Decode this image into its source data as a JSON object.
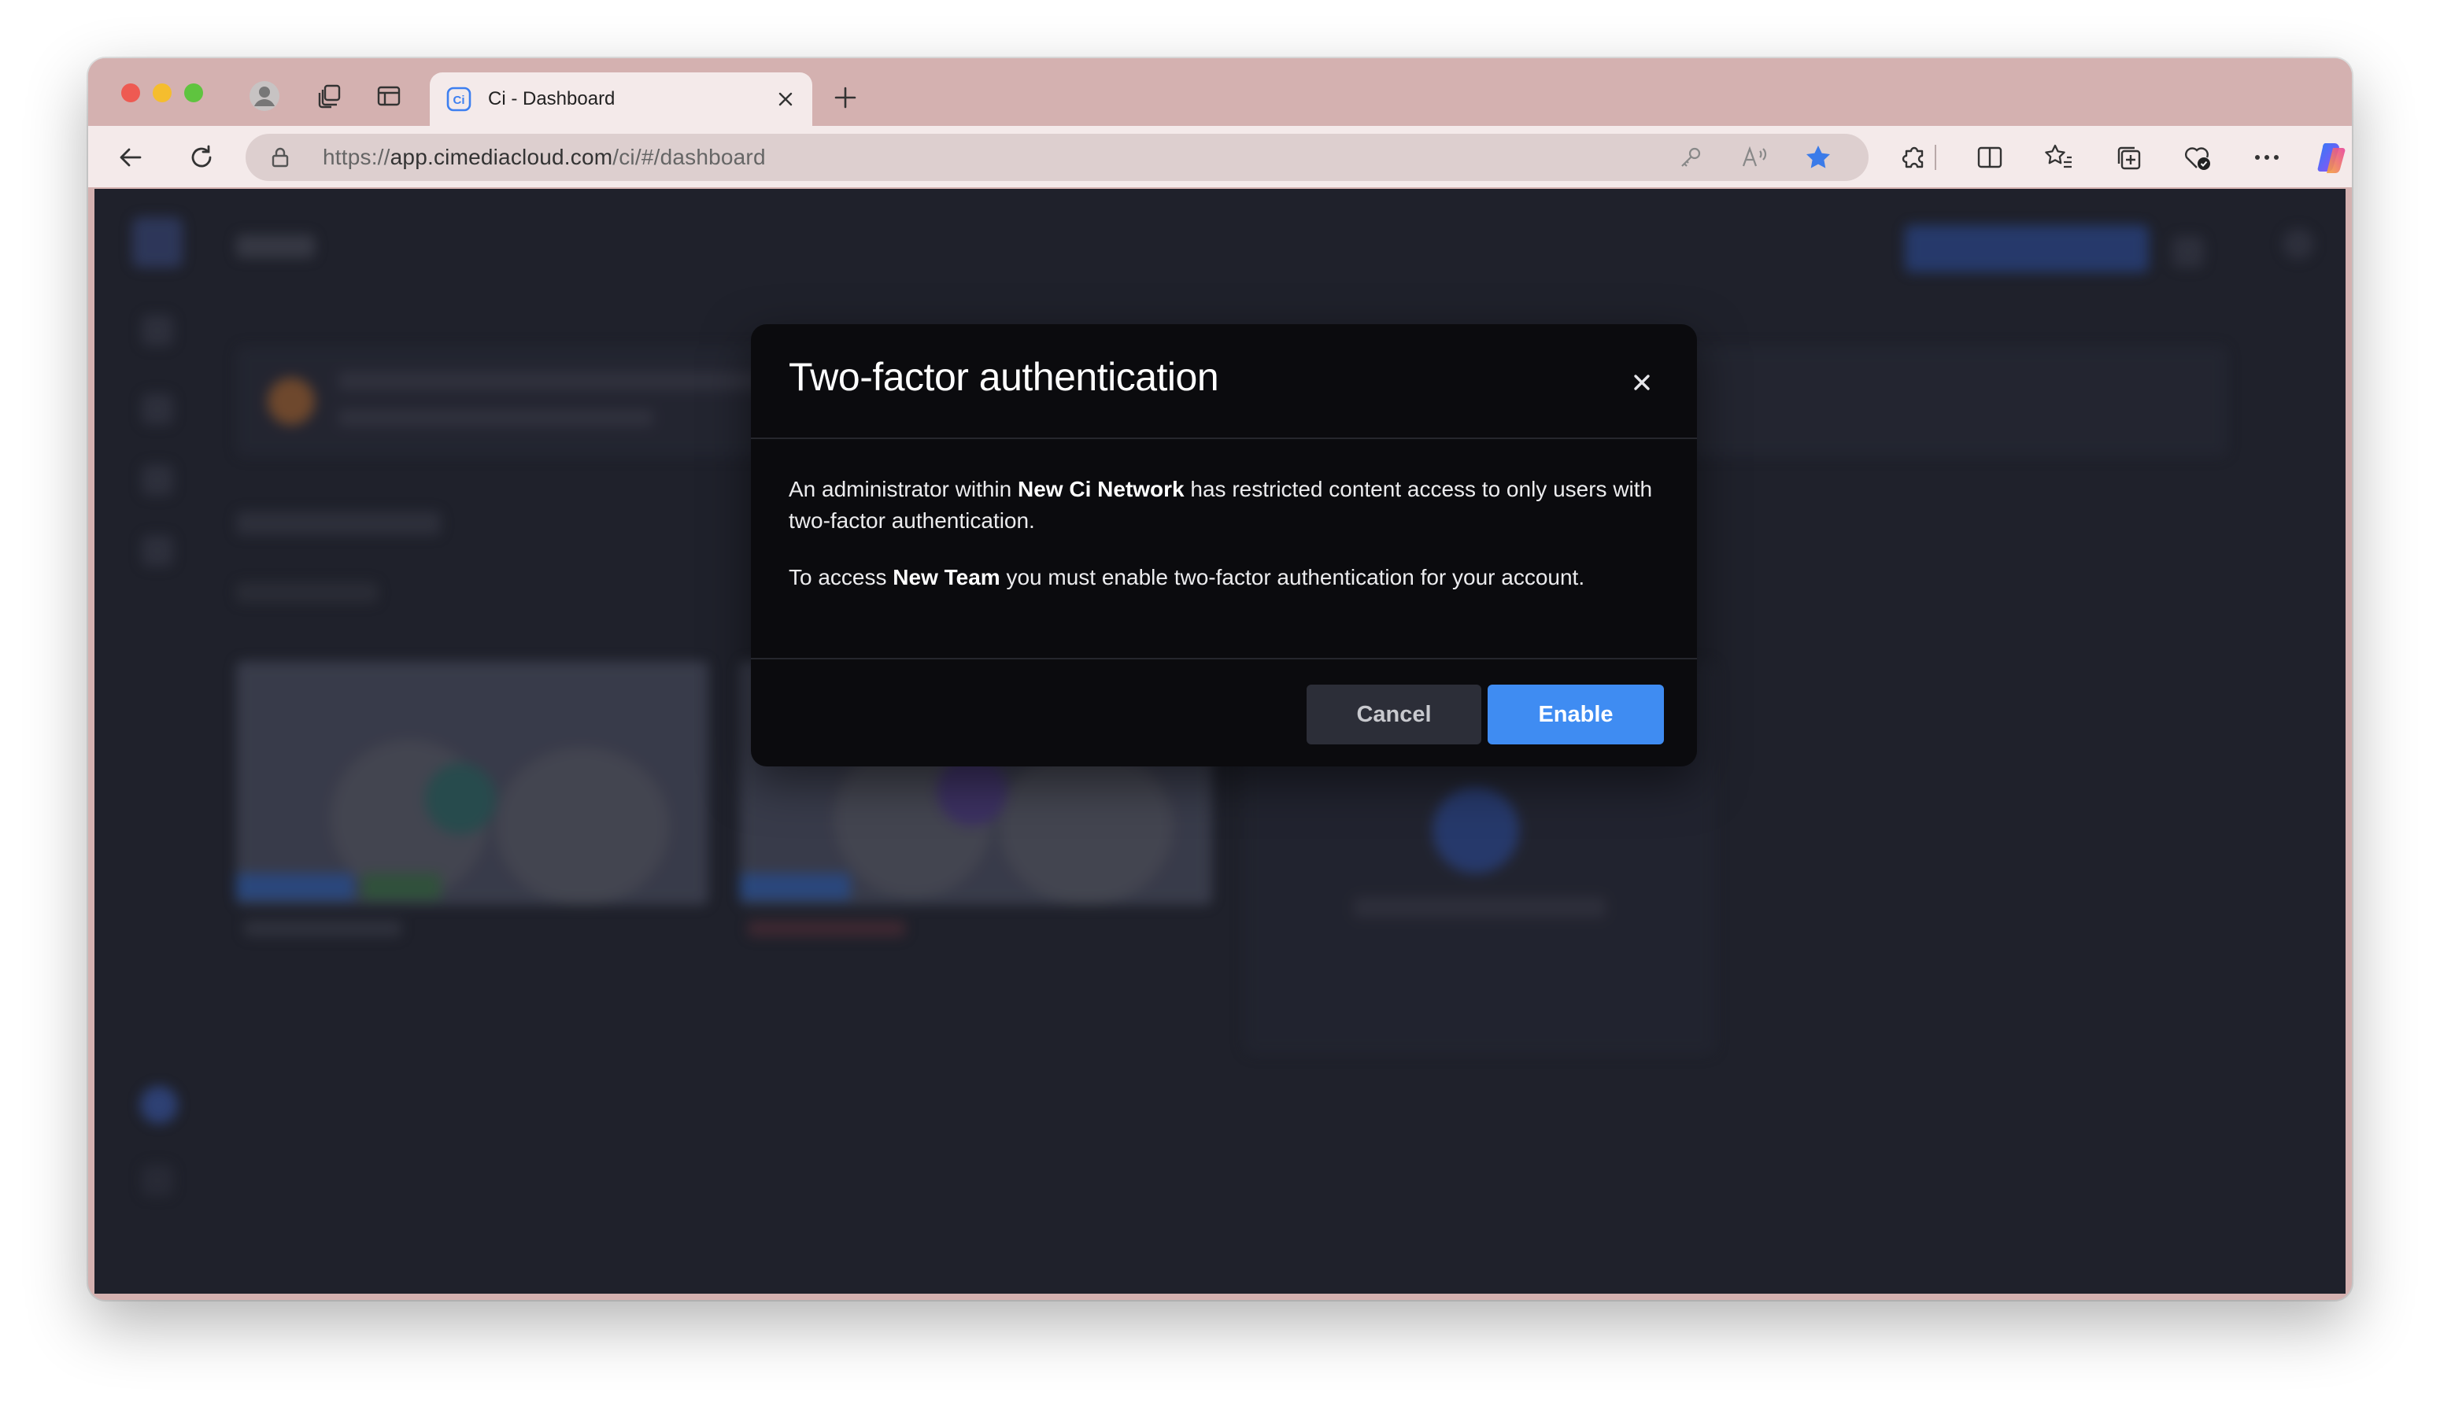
{
  "browser": {
    "tab": {
      "title": "Ci - Dashboard"
    },
    "address": {
      "url_prefix": "https://",
      "url_host": "app.cimediacloud.com",
      "url_path": "/ci/#/dashboard"
    },
    "icons": [
      "profile-icon",
      "workspaces-icon",
      "vertical-tabs-icon",
      "new-tab-icon",
      "back-icon",
      "refresh-icon",
      "lock-icon",
      "key-icon",
      "read-aloud-icon",
      "favorite-star-icon",
      "extensions-icon",
      "split-screen-icon",
      "favorites-icon",
      "collections-icon",
      "browser-essentials-icon",
      "more-icon",
      "copilot-icon"
    ],
    "colors": {
      "frame": "#d4b1b0",
      "toolbar": "#f4eaea",
      "star": "#3b7be9"
    }
  },
  "modal": {
    "title": "Two-factor authentication",
    "body": {
      "p1_prefix": "An administrator within ",
      "p1_bold": "New Ci Network",
      "p1_suffix": " has restricted content access to only users with two-factor authentication.",
      "p2_prefix": "To access ",
      "p2_bold": "New Team",
      "p2_suffix": " you must enable two-factor authentication for your account."
    },
    "buttons": {
      "cancel": "Cancel",
      "enable": "Enable"
    },
    "colors": {
      "background": "#0b0b0e",
      "primary": "#3f8cf2",
      "secondary": "#2c2e38",
      "page_backdrop": "#1f212b"
    }
  }
}
